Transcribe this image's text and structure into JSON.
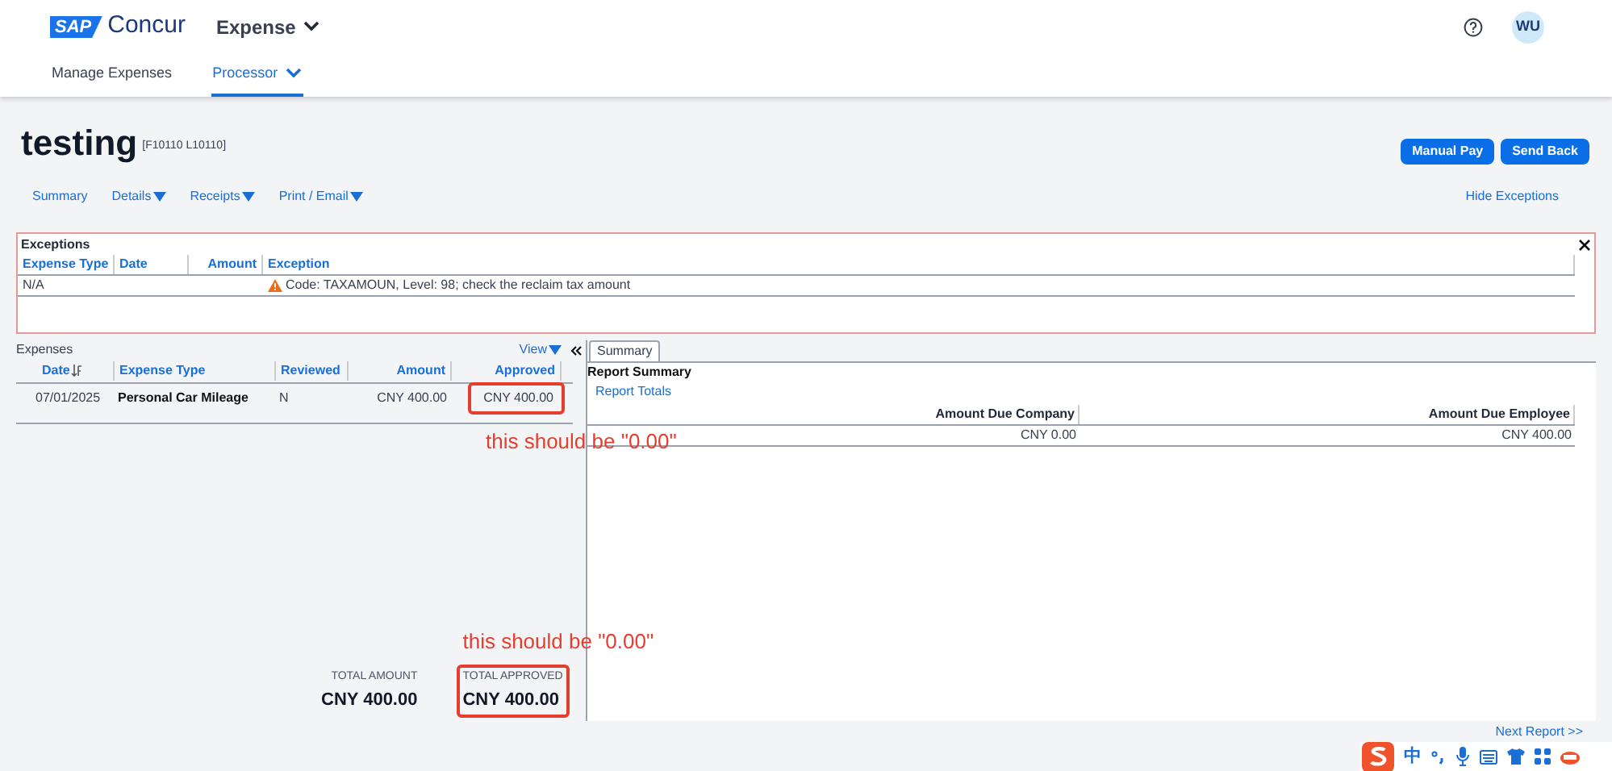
{
  "header": {
    "logo": {
      "mark": "SAP",
      "name": "Concur"
    },
    "product_menu": "Expense",
    "nav_tabs": [
      {
        "label": "Manage Expenses",
        "selected": false,
        "dropdown": false
      },
      {
        "label": "Processor",
        "selected": true,
        "dropdown": true
      }
    ],
    "avatar": "WU"
  },
  "report": {
    "title": "testing",
    "code": "[F10110 L10110]"
  },
  "actions": [
    "Manual Pay",
    "Send Back"
  ],
  "links": [
    {
      "label": "Summary",
      "dropdown": false
    },
    {
      "label": "Details",
      "dropdown": true
    },
    {
      "label": "Receipts",
      "dropdown": true
    },
    {
      "label": "Print / Email",
      "dropdown": true
    }
  ],
  "hide_exceptions": "Hide Exceptions",
  "exceptions": {
    "title": "Exceptions",
    "columns": [
      "Expense Type",
      "Date",
      "Amount",
      "Exception"
    ],
    "rows": [
      {
        "expense_type": "N/A",
        "exception": "Code: TAXAMOUN, Level: 98; check the reclaim tax amount"
      }
    ]
  },
  "expenses": {
    "title": "Expenses",
    "view": "View",
    "columns": [
      "Date",
      "Expense Type",
      "Reviewed",
      "Amount",
      "Approved"
    ],
    "rows": [
      {
        "date": "07/01/2025",
        "expense_type": "Personal Car Mileage",
        "reviewed": "N",
        "amount": "CNY 400.00",
        "approved": "CNY 400.00",
        "flagged": true,
        "note": "this should be \"0.00\""
      }
    ]
  },
  "summary": {
    "tab": "Summary",
    "title": "Report Summary",
    "link": "Report Totals",
    "columns": [
      "Amount Due Company",
      "Amount Due Employee"
    ],
    "rows": [
      [
        "CNY 0.00",
        "CNY 400.00"
      ]
    ]
  },
  "totals": [
    {
      "label": "TOTAL AMOUNT",
      "value": "CNY 400.00",
      "flagged": false
    },
    {
      "label": "TOTAL APPROVED",
      "value": "CNY 400.00",
      "flagged": true,
      "note": "this should be \"0.00\""
    }
  ],
  "next_report": "Next Report >>",
  "ime_toolbar": {
    "mode": "中"
  }
}
